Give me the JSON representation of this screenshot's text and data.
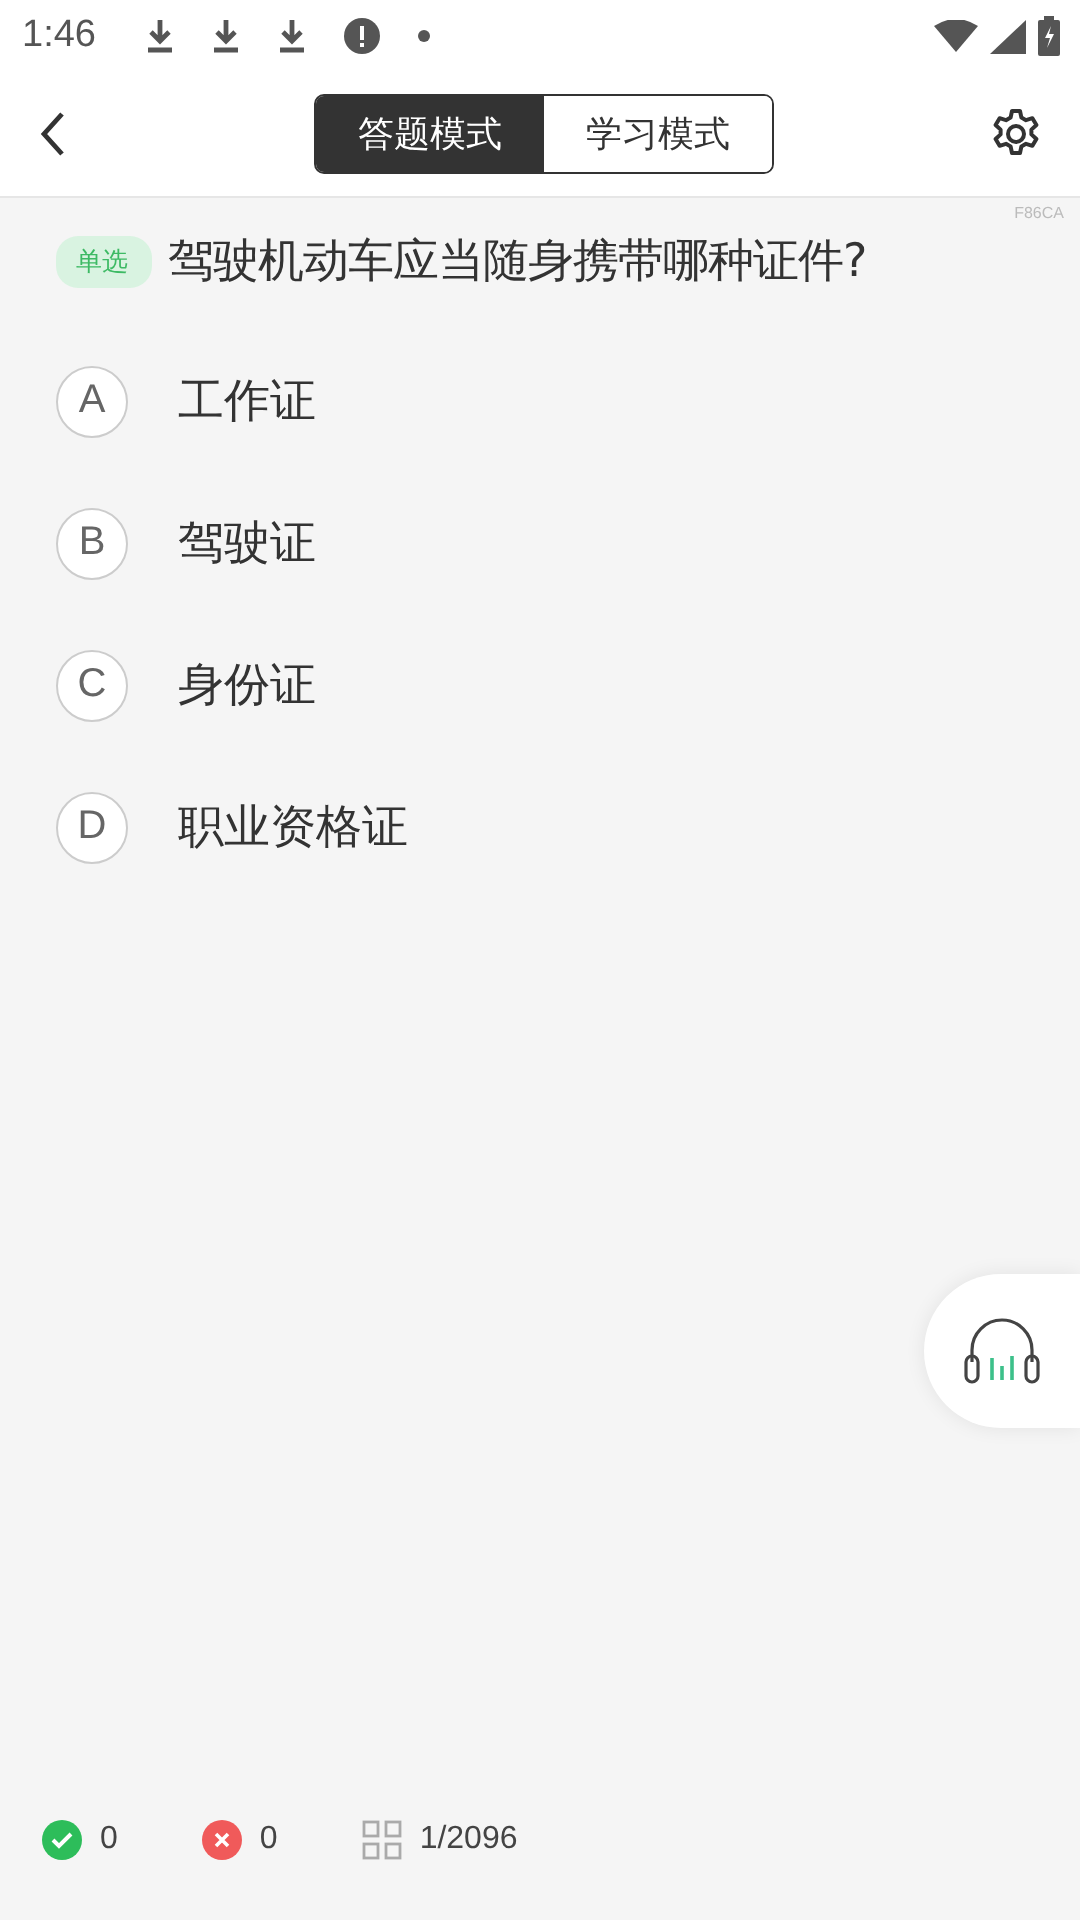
{
  "status_bar": {
    "time": "1:46"
  },
  "header": {
    "tabs": [
      {
        "label": "答题模式",
        "selected": true
      },
      {
        "label": "学习模式",
        "selected": false
      }
    ]
  },
  "question": {
    "code": "F86CA",
    "type_tag": "单选",
    "text": "驾驶机动车应当随身携带哪种证件?"
  },
  "options": [
    {
      "letter": "A",
      "text": "工作证"
    },
    {
      "letter": "B",
      "text": "驾驶证"
    },
    {
      "letter": "C",
      "text": "身份证"
    },
    {
      "letter": "D",
      "text": "职业资格证"
    }
  ],
  "footer": {
    "correct": "0",
    "wrong": "0",
    "progress": "1/2096"
  }
}
